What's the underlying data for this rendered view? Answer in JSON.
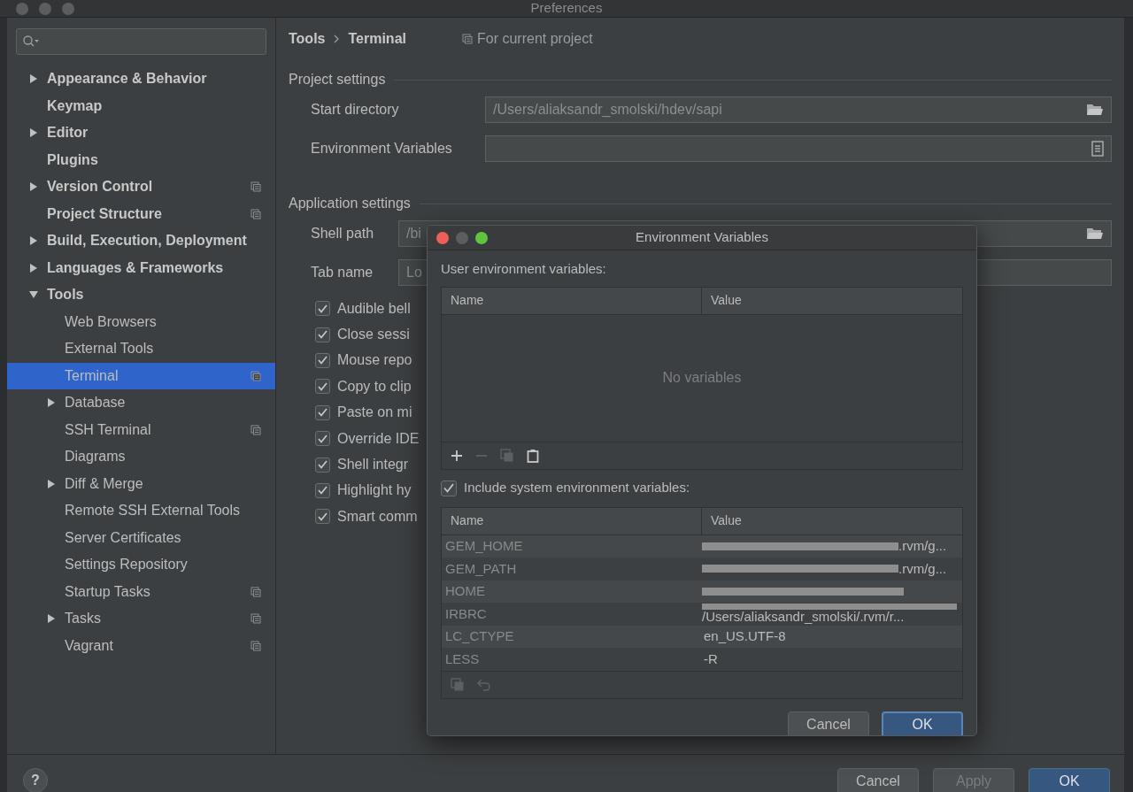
{
  "window": {
    "title": "Preferences"
  },
  "sidebar": {
    "items": [
      {
        "label": "Appearance & Behavior",
        "expanded": false,
        "selected": false,
        "project_scoped": false
      },
      {
        "label": "Keymap",
        "selected": false,
        "project_scoped": false
      },
      {
        "label": "Editor",
        "expanded": false,
        "selected": false,
        "project_scoped": false
      },
      {
        "label": "Plugins",
        "selected": false,
        "project_scoped": false
      },
      {
        "label": "Version Control",
        "expanded": false,
        "selected": false,
        "project_scoped": true
      },
      {
        "label": "Project Structure",
        "selected": false,
        "project_scoped": true
      },
      {
        "label": "Build, Execution, Deployment",
        "expanded": false,
        "selected": false,
        "project_scoped": false
      },
      {
        "label": "Languages & Frameworks",
        "expanded": false,
        "selected": false,
        "project_scoped": false
      },
      {
        "label": "Tools",
        "expanded": true,
        "selected": false,
        "project_scoped": false,
        "children": [
          {
            "label": "Web Browsers",
            "selected": false,
            "project_scoped": false
          },
          {
            "label": "External Tools",
            "selected": false,
            "project_scoped": false
          },
          {
            "label": "Terminal",
            "selected": true,
            "project_scoped": true
          },
          {
            "label": "Database",
            "expanded": false,
            "selected": false,
            "project_scoped": false
          },
          {
            "label": "SSH Terminal",
            "selected": false,
            "project_scoped": true
          },
          {
            "label": "Diagrams",
            "selected": false,
            "project_scoped": false
          },
          {
            "label": "Diff & Merge",
            "expanded": false,
            "selected": false,
            "project_scoped": false
          },
          {
            "label": "Remote SSH External Tools",
            "selected": false,
            "project_scoped": false
          },
          {
            "label": "Server Certificates",
            "selected": false,
            "project_scoped": false
          },
          {
            "label": "Settings Repository",
            "selected": false,
            "project_scoped": false
          },
          {
            "label": "Startup Tasks",
            "selected": false,
            "project_scoped": true
          },
          {
            "label": "Tasks",
            "expanded": false,
            "selected": false,
            "project_scoped": true
          },
          {
            "label": "Vagrant",
            "selected": false,
            "project_scoped": true
          }
        ]
      }
    ]
  },
  "breadcrumb": [
    "Tools",
    "Terminal"
  ],
  "scope_note": "For current project",
  "project_settings": {
    "title": "Project settings",
    "fields": [
      {
        "label": "Start directory",
        "value": "/Users/aliaksandr_smolski/hdev/sapi",
        "kind": "folder"
      },
      {
        "label": "Environment Variables",
        "kind": "list"
      }
    ]
  },
  "application_settings": {
    "title": "Application settings",
    "fields": [
      {
        "label": "Shell path",
        "value": "/bi",
        "kind": "folder"
      },
      {
        "label": "Tab name",
        "value": "Lo",
        "kind": "text"
      }
    ],
    "checkboxes": [
      {
        "label": "Audible bell",
        "checked": true
      },
      {
        "label": "Close sessi",
        "checked": true
      },
      {
        "label": "Mouse repo",
        "checked": true
      },
      {
        "label": "Copy to clip",
        "checked": true
      },
      {
        "label": "Paste on mi",
        "checked": true
      },
      {
        "label": "Override IDE",
        "checked": true
      },
      {
        "label": "Shell integr",
        "checked": true
      },
      {
        "label": "Highlight hy",
        "checked": true
      },
      {
        "label": "Smart comm",
        "checked": true
      }
    ]
  },
  "dialog": {
    "title": "Environment Variables",
    "user_section": {
      "title": "User environment variables:",
      "columns": [
        "Name",
        "Value"
      ],
      "empty_text": "No variables"
    },
    "include_system": {
      "label": "Include system environment variables:",
      "checked": true
    },
    "system_table": {
      "columns": [
        "Name",
        "Value"
      ],
      "rows": [
        {
          "name": "GEM_HOME",
          "value": ".rvm/g...",
          "redacted": true
        },
        {
          "name": "GEM_PATH",
          "value": ".rvm/g...",
          "redacted": true
        },
        {
          "name": "HOME",
          "redacted": true
        },
        {
          "name": "IRBRC",
          "value": "/Users/aliaksandr_smolski/.rvm/r...",
          "redacted": true
        },
        {
          "name": "LC_CTYPE",
          "value": "en_US.UTF-8",
          "redacted": false
        },
        {
          "name": "LESS",
          "value": "-R",
          "redacted": false
        }
      ]
    },
    "buttons": [
      {
        "label": "Cancel",
        "default": false
      },
      {
        "label": "OK",
        "default": true
      }
    ]
  },
  "footer": {
    "help": "?",
    "buttons": [
      {
        "label": "Cancel",
        "default": false,
        "disabled": false
      },
      {
        "label": "Apply",
        "default": false,
        "disabled": true
      },
      {
        "label": "OK",
        "default": true,
        "disabled": false
      }
    ]
  }
}
